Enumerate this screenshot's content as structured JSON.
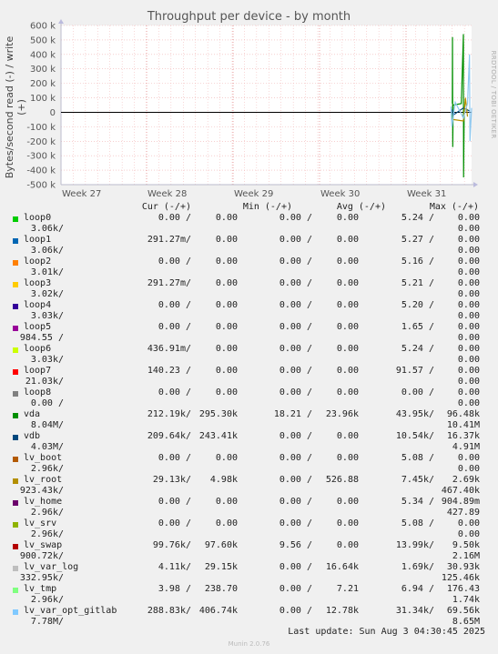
{
  "chart_data": {
    "type": "line",
    "title": "Throughput per device - by month",
    "ylabel": "Bytes/second read (-) / write (+)",
    "ylim": [
      -500000,
      600000
    ],
    "y_ticks": [
      "600 k",
      "500 k",
      "400 k",
      "300 k",
      "200 k",
      "100 k",
      "0",
      "-100 k",
      "-200 k",
      "-300 k",
      "-400 k",
      "-500 k"
    ],
    "y_tick_values": [
      600000,
      500000,
      400000,
      300000,
      200000,
      100000,
      0,
      -100000,
      -200000,
      -300000,
      -400000,
      -500000
    ],
    "x_ticks": [
      "Week 27",
      "Week 28",
      "Week 29",
      "Week 30",
      "Week 31"
    ],
    "grid": true,
    "series": [
      {
        "name": "vda",
        "color": "#008f00",
        "values": [
          [
            0.953,
            60000
          ],
          [
            0.9535,
            520000
          ],
          [
            0.954,
            -240000
          ],
          [
            0.955,
            50000
          ],
          [
            0.975,
            60000
          ],
          [
            0.98,
            540000
          ],
          [
            0.9805,
            -450000
          ],
          [
            0.982,
            40000
          ]
        ]
      },
      {
        "name": "vdb",
        "color": "#00487d",
        "values": [
          [
            0.953,
            20000
          ],
          [
            0.955,
            -20000
          ],
          [
            0.98,
            30000
          ],
          [
            0.995,
            10000
          ]
        ]
      },
      {
        "name": "lv_root",
        "color": "#b38f00",
        "values": [
          [
            0.955,
            -50000
          ],
          [
            0.98,
            -60000
          ],
          [
            0.985,
            100000
          ],
          [
            0.99,
            -30000
          ]
        ]
      },
      {
        "name": "lv_var_opt_gitlab",
        "color": "#8fc8ef",
        "values": [
          [
            0.95,
            40000
          ],
          [
            0.952,
            -100000
          ],
          [
            0.96,
            70000
          ],
          [
            0.98,
            -40000
          ],
          [
            0.99,
            60000
          ],
          [
            0.995,
            400000
          ],
          [
            0.996,
            -200000
          ],
          [
            1.0,
            30000
          ]
        ]
      }
    ]
  },
  "side_text": "RRDTOOL / TOBI OETIKER",
  "legend_header": {
    "cur": "Cur (-/+)",
    "min": "Min (-/+)",
    "avg": "Avg (-/+)",
    "max": "Max (-/+)"
  },
  "rows": [
    {
      "name": "loop0",
      "color": "#00cc00",
      "cur_r": "0.00 /",
      "cur_w": "0.00",
      "min_r": "0.00 /",
      "min_w": "0.00",
      "avg_r": "5.24 /",
      "max_w": "0.00",
      "line2": "3.06k/",
      "line2_max": "0.00"
    },
    {
      "name": "loop1",
      "color": "#0066b3",
      "cur_r": "291.27m/",
      "cur_w": "0.00",
      "min_r": "0.00 /",
      "min_w": "0.00",
      "avg_r": "5.27 /",
      "max_w": "0.00",
      "line2": "3.06k/",
      "line2_max": "0.00"
    },
    {
      "name": "loop2",
      "color": "#ff8000",
      "cur_r": "0.00 /",
      "cur_w": "0.00",
      "min_r": "0.00 /",
      "min_w": "0.00",
      "avg_r": "5.16 /",
      "max_w": "0.00",
      "line2": "3.01k/",
      "line2_max": "0.00"
    },
    {
      "name": "loop3",
      "color": "#ffcc00",
      "cur_r": "291.27m/",
      "cur_w": "0.00",
      "min_r": "0.00 /",
      "min_w": "0.00",
      "avg_r": "5.21 /",
      "max_w": "0.00",
      "line2": "3.02k/",
      "line2_max": "0.00"
    },
    {
      "name": "loop4",
      "color": "#330099",
      "cur_r": "0.00 /",
      "cur_w": "0.00",
      "min_r": "0.00 /",
      "min_w": "0.00",
      "avg_r": "5.20 /",
      "max_w": "0.00",
      "line2": "3.03k/",
      "line2_max": "0.00"
    },
    {
      "name": "loop5",
      "color": "#990099",
      "cur_r": "0.00 /",
      "cur_w": "0.00",
      "min_r": "0.00 /",
      "min_w": "0.00",
      "avg_r": "1.65 /",
      "max_w": "0.00",
      "line2": "984.55 /",
      "line2_max": "0.00"
    },
    {
      "name": "loop6",
      "color": "#ccff00",
      "cur_r": "436.91m/",
      "cur_w": "0.00",
      "min_r": "0.00 /",
      "min_w": "0.00",
      "avg_r": "5.24 /",
      "max_w": "0.00",
      "line2": "3.03k/",
      "line2_max": "0.00"
    },
    {
      "name": "loop7",
      "color": "#ff0000",
      "cur_r": "140.23 /",
      "cur_w": "0.00",
      "min_r": "0.00 /",
      "min_w": "0.00",
      "avg_r": "91.57 /",
      "max_w": "0.00",
      "line2": "21.03k/",
      "line2_max": "0.00"
    },
    {
      "name": "loop8",
      "color": "#808080",
      "cur_r": "0.00 /",
      "cur_w": "0.00",
      "min_r": "0.00 /",
      "min_w": "0.00",
      "avg_r": "0.00 /",
      "max_w": "0.00",
      "line2": "0.00 /",
      "line2_max": "0.00"
    },
    {
      "name": "vda",
      "color": "#008f00",
      "cur_r": "212.19k/",
      "cur_w": "295.30k",
      "min_r": "18.21 /",
      "min_w": "23.96k",
      "avg_r": "43.95k/",
      "max_w": "96.48k",
      "line2": "8.04M/",
      "line2_max": "10.41M"
    },
    {
      "name": "vdb",
      "color": "#00487d",
      "cur_r": "209.64k/",
      "cur_w": "243.41k",
      "min_r": "0.00 /",
      "min_w": "0.00",
      "avg_r": "10.54k/",
      "max_w": "16.37k",
      "line2": "4.03M/",
      "line2_max": "4.91M"
    },
    {
      "name": "lv_boot",
      "color": "#b35a00",
      "cur_r": "0.00 /",
      "cur_w": "0.00",
      "min_r": "0.00 /",
      "min_w": "0.00",
      "avg_r": "5.08 /",
      "max_w": "0.00",
      "line2": "2.96k/",
      "line2_max": "0.00"
    },
    {
      "name": "lv_root",
      "color": "#b38f00",
      "cur_r": "29.13k/",
      "cur_w": "4.98k",
      "min_r": "0.00 /",
      "min_w": "526.88",
      "avg_r": "7.45k/",
      "max_w": "2.69k",
      "line2": "923.43k/",
      "line2_max": "467.40k"
    },
    {
      "name": "lv_home",
      "color": "#6b006b",
      "cur_r": "0.00 /",
      "cur_w": "0.00",
      "min_r": "0.00 /",
      "min_w": "0.00",
      "avg_r": "5.34 /",
      "max_w": "904.89m",
      "line2": "2.96k/",
      "line2_max": "427.89"
    },
    {
      "name": "lv_srv",
      "color": "#8fb300",
      "cur_r": "0.00 /",
      "cur_w": "0.00",
      "min_r": "0.00 /",
      "min_w": "0.00",
      "avg_r": "5.08 /",
      "max_w": "0.00",
      "line2": "2.96k/",
      "line2_max": "0.00"
    },
    {
      "name": "lv_swap",
      "color": "#b30000",
      "cur_r": "99.76k/",
      "cur_w": "97.60k",
      "min_r": "9.56 /",
      "min_w": "0.00",
      "avg_r": "13.99k/",
      "max_w": "9.50k",
      "line2": "900.72k/",
      "line2_max": "2.16M"
    },
    {
      "name": "lv_var_log",
      "color": "#bebebe",
      "cur_r": "4.11k/",
      "cur_w": "29.15k",
      "min_r": "0.00 /",
      "min_w": "16.64k",
      "avg_r": "1.69k/",
      "max_w": "30.93k",
      "line2": "332.95k/",
      "line2_max": "125.46k"
    },
    {
      "name": "lv_tmp",
      "color": "#80ff80",
      "cur_r": "3.98 /",
      "cur_w": "238.70",
      "min_r": "0.00 /",
      "min_w": "7.21",
      "avg_r": "6.94 /",
      "max_w": "176.43",
      "line2": "2.96k/",
      "line2_max": "1.74k"
    },
    {
      "name": "lv_var_opt_gitlab",
      "color": "#80c9ff",
      "cur_r": "288.83k/",
      "cur_w": "406.74k",
      "min_r": "0.00 /",
      "min_w": "12.78k",
      "avg_r": "31.34k/",
      "max_w": "69.56k",
      "line2": "7.78M/",
      "line2_max": "8.65M"
    }
  ],
  "last_update": "Last update: Sun Aug  3 04:30:45 2025",
  "version": "Munin 2.0.76"
}
